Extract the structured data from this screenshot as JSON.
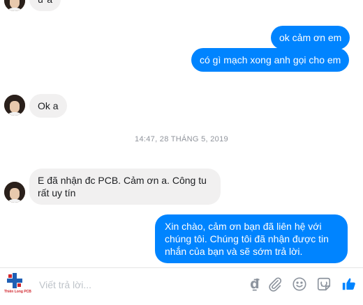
{
  "thread": {
    "messages": [
      {
        "side": "in",
        "text": "ừ a"
      },
      {
        "side": "out",
        "text": "ok cảm ơn em"
      },
      {
        "side": "out",
        "text": "có gì mạch xong anh gọi cho em"
      },
      {
        "side": "in",
        "text": "Ok a"
      },
      {
        "side": "in",
        "text": "E đã nhận đc PCB. Cảm ơn a. Công tu rất uy tín"
      },
      {
        "side": "out",
        "text": "Xin chào, cảm ơn bạn đã liên hệ với chúng tôi. Chúng tôi đã nhận được tin nhắn của bạn và sẽ sớm trả lời."
      }
    ],
    "timestamp": "14:47, 28 THÁNG 5, 2019"
  },
  "composer": {
    "placeholder": "Viết trả lời...",
    "logo_text": "Thiên Long PCB",
    "currency_symbol": "₫"
  },
  "colors": {
    "outgoing_bubble": "#0084ff",
    "incoming_bubble": "#f1f0f0",
    "icon_gray": "#8d949e",
    "like_blue": "#0084ff"
  },
  "icons": [
    "avatar",
    "logo",
    "currency-icon",
    "paperclip-icon",
    "emoji-icon",
    "gif-icon",
    "like-icon"
  ]
}
